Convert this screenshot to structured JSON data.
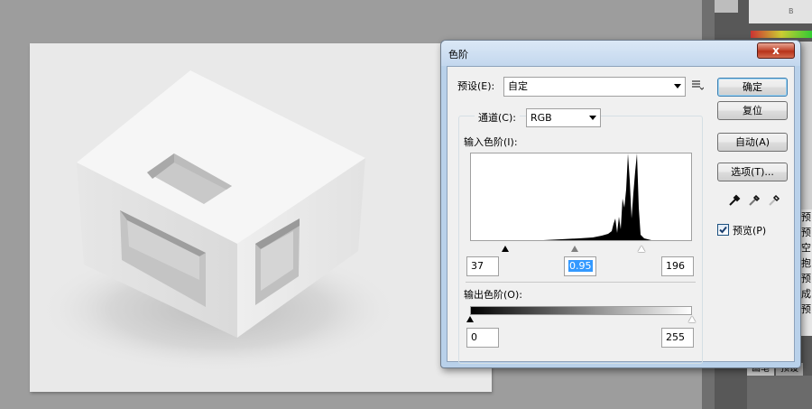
{
  "dialog": {
    "title": "色阶",
    "close_glyph": "x",
    "preset": {
      "label": "预设(E):",
      "value": "自定",
      "menu_icon": "list-options-icon"
    },
    "channel": {
      "label": "通道(C):",
      "value": "RGB"
    },
    "input_levels": {
      "label": "输入色阶(I):",
      "black": "37",
      "gamma": "0.95",
      "white": "196"
    },
    "output_levels": {
      "label": "输出色阶(O):",
      "black": "0",
      "white": "255"
    },
    "buttons": {
      "ok": "确定",
      "reset": "复位",
      "auto": "自动(A)",
      "options": "选项(T)..."
    },
    "eyedroppers": [
      "black-eyedropper-icon",
      "gray-eyedropper-icon",
      "white-eyedropper-icon"
    ],
    "preview": {
      "label": "预览(P)",
      "checked": true
    }
  },
  "right_panel": {
    "channel_letter": "B",
    "side_labels": [
      "预",
      "预",
      "空",
      "抱",
      "预",
      "成",
      "预"
    ],
    "bottom_tabs": [
      "画笔",
      "预设"
    ]
  },
  "colors": {
    "workspace": "#9d9d9d",
    "dialog_frame": "#b9d1ea",
    "close_button": "#c44e36",
    "selection": "#3399ff"
  }
}
